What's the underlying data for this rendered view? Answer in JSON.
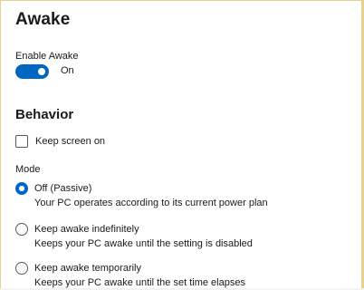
{
  "page": {
    "title": "Awake"
  },
  "enable": {
    "label": "Enable Awake",
    "state_text": "On",
    "on": true
  },
  "behavior": {
    "heading": "Behavior",
    "keep_screen_on": {
      "label": "Keep screen on",
      "checked": false
    }
  },
  "mode": {
    "label": "Mode",
    "options": [
      {
        "title": "Off (Passive)",
        "description": "Your PC operates according to its current power plan",
        "selected": true
      },
      {
        "title": "Keep awake indefinitely",
        "description": "Keeps your PC awake until the setting is disabled",
        "selected": false
      },
      {
        "title": "Keep awake temporarily",
        "description": "Keeps your PC awake until the set time elapses",
        "selected": false
      }
    ]
  },
  "colors": {
    "accent": "#0067c0",
    "frame_border": "#e4d28a"
  }
}
